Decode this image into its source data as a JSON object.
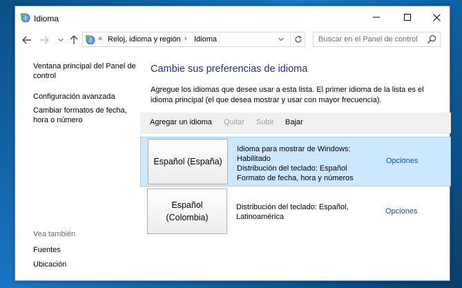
{
  "window": {
    "title": "Idioma",
    "title_icon": "control-panel-icon"
  },
  "address": {
    "chevrons": "«",
    "crumbs": [
      "Reloj, idioma y región",
      "Idioma"
    ],
    "separator": "›"
  },
  "search": {
    "placeholder": "Buscar en el Panel de control"
  },
  "left_nav": {
    "links": [
      "Ventana principal del Panel de control",
      "Configuración avanzada",
      "Cambiar formatos de fecha, hora o número"
    ],
    "see_also_title": "Vea también",
    "see_also": [
      "Fuentes",
      "Ubicación"
    ]
  },
  "main": {
    "heading": "Cambie sus preferencias de idioma",
    "description": "Agregue los idiomas que desee usar a esta lista. El primer idioma de la lista es el idioma principal (el que desea mostrar y usar con mayor frecuencia).",
    "toolbar": {
      "add": "Agregar un idioma",
      "remove": "Quitar",
      "up": "Subir",
      "down": "Bajar"
    },
    "languages": [
      {
        "name_line1": "Español (España)",
        "name_line2": "",
        "details": [
          "Idioma para mostrar de Windows: Habilitado",
          "Distribución del teclado: Español",
          "Formato de fecha, hora y números"
        ],
        "options": "Opciones",
        "selected": true
      },
      {
        "name_line1": "Español",
        "name_line2": "(Colombia)",
        "details": [
          "Distribución del teclado: Español, Latinoamérica"
        ],
        "options": "Opciones",
        "selected": false
      }
    ]
  },
  "colors": {
    "heading": "#1e3287",
    "link": "#0f4ea8",
    "selected_row": "#cce8ff",
    "desktop": "#1876c4"
  }
}
